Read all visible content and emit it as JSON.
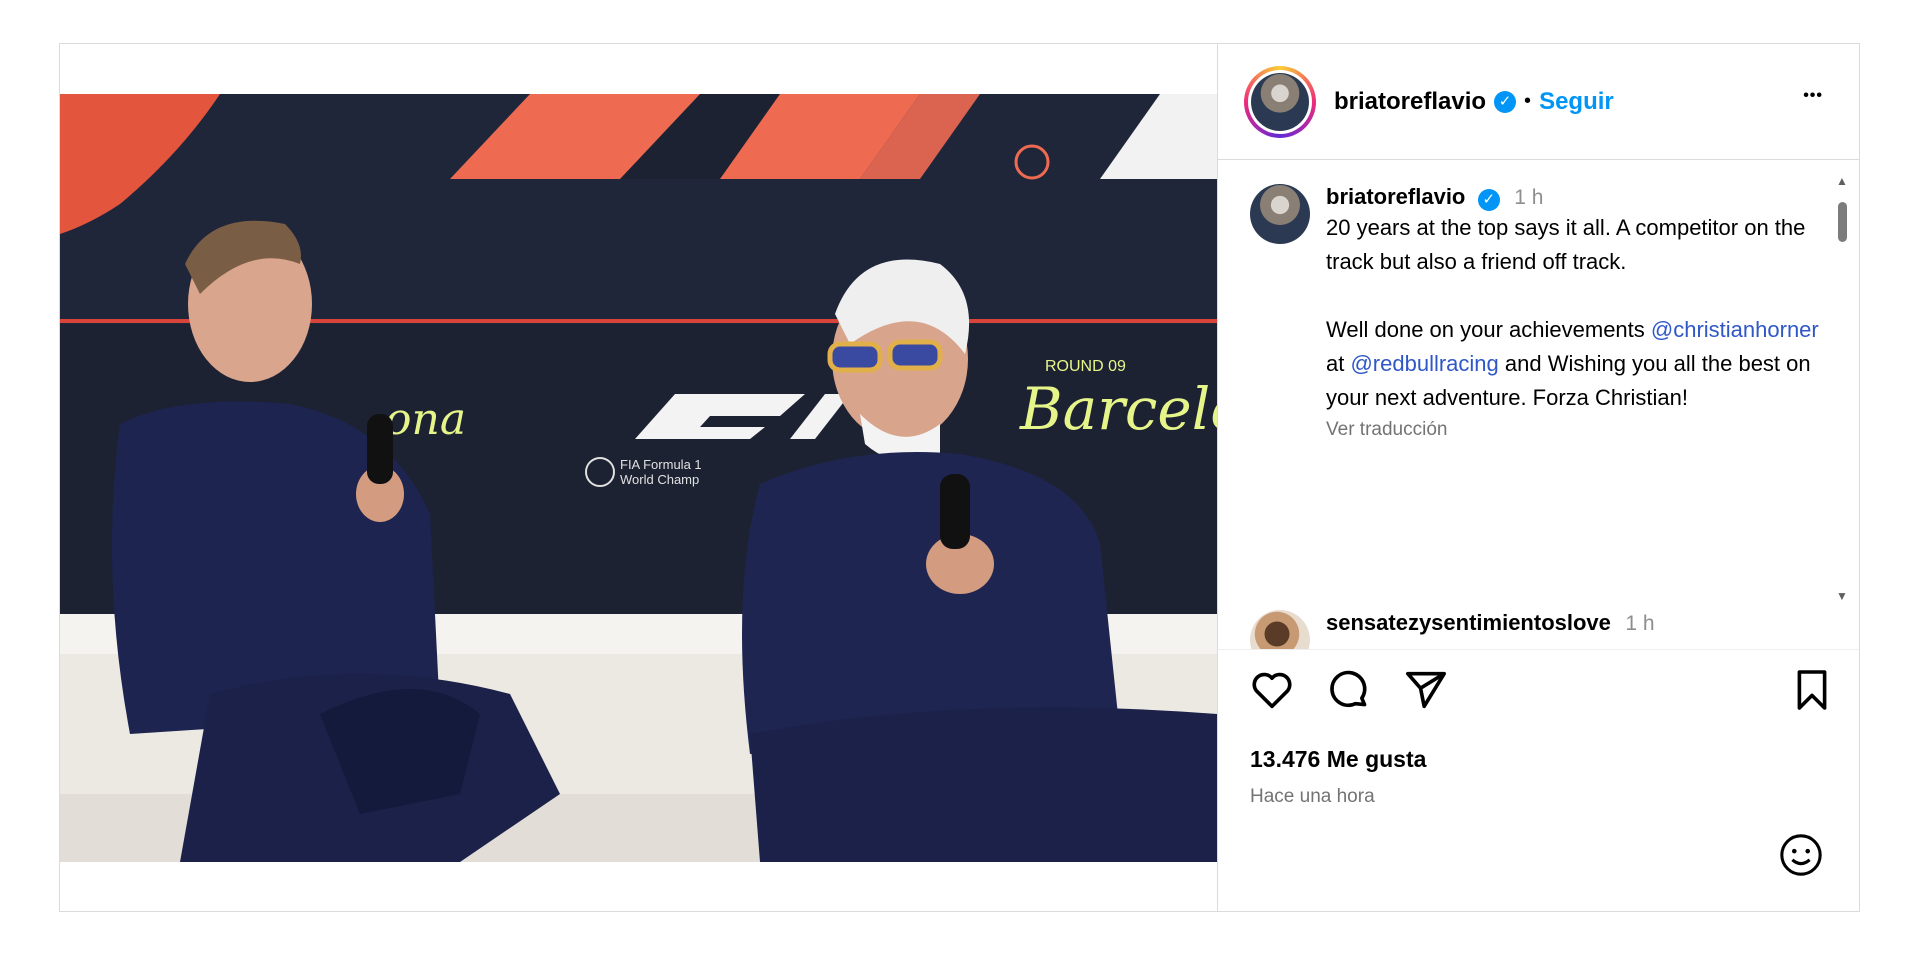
{
  "post": {
    "username": "briatoreflavio",
    "verified_mark": "✓",
    "separator": "•",
    "follow_label": "Seguir",
    "more_label": "•••"
  },
  "media": {
    "description": "Press conference photo",
    "backdrop_words": [
      "ROUND 09",
      "Barcelona",
      "ona",
      "FIA Formula 1",
      "World Champ"
    ]
  },
  "caption": {
    "username": "briatoreflavio",
    "time": "1 h",
    "line1": "20 years at the top says it all. A competitor on the track but also a friend off track.",
    "line2_pre": "Well done on your achievements ",
    "mention1": "@christianhorner",
    "mid": " at ",
    "mention2": "@redbullracing",
    "line2_post": " and Wishing you all the best on your next adventure. Forza Christian!",
    "translate": "Ver traducción"
  },
  "comments": [
    {
      "username": "sensatezysentimientoslove",
      "time": "1 h"
    }
  ],
  "engagement": {
    "likes": "13.476 Me gusta",
    "timeago": "Hace una hora"
  },
  "icons": {
    "like": "heart-icon",
    "comment": "comment-icon",
    "share": "paper-plane-icon",
    "save": "bookmark-icon",
    "emoji": "smiley-icon"
  },
  "colors": {
    "accent": "#0095f6",
    "mention": "#2f57c7",
    "muted": "#737373",
    "border": "#dbdbdb"
  }
}
